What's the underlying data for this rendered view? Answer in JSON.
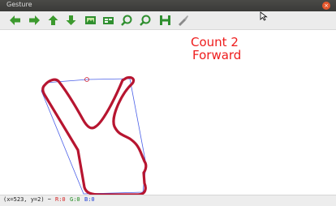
{
  "window": {
    "title": "Gesture",
    "close_glyph": "×"
  },
  "toolbar": {
    "buttons": [
      {
        "name": "back-arrow-icon",
        "color": "#3c9a2e"
      },
      {
        "name": "forward-arrow-icon",
        "color": "#3c9a2e"
      },
      {
        "name": "up-arrow-icon",
        "color": "#3c9a2e"
      },
      {
        "name": "down-arrow-icon",
        "color": "#3c9a2e"
      },
      {
        "name": "save-image-icon",
        "color": "#2f8f2f"
      },
      {
        "name": "properties-icon",
        "color": "#2f8f2f"
      },
      {
        "name": "zoom-in-icon",
        "color": "#2f8f2f"
      },
      {
        "name": "zoom-out-icon",
        "color": "#2f8f2f"
      },
      {
        "name": "save-icon",
        "color": "#2f8f2f"
      },
      {
        "name": "pan-tool-icon",
        "color": "#8a8a8a"
      }
    ]
  },
  "overlay": {
    "line1": "Count 2",
    "line2": "Forward",
    "color": "#ee1c1c"
  },
  "status": {
    "coords": "(x=523, y=2) ~",
    "r": "R:0",
    "g": "G:0",
    "b": "B:0"
  },
  "colors": {
    "contour": "#b71530",
    "hull": "#4a5fe8",
    "titlebar": "#3f3f3d",
    "close": "#e6572c"
  }
}
